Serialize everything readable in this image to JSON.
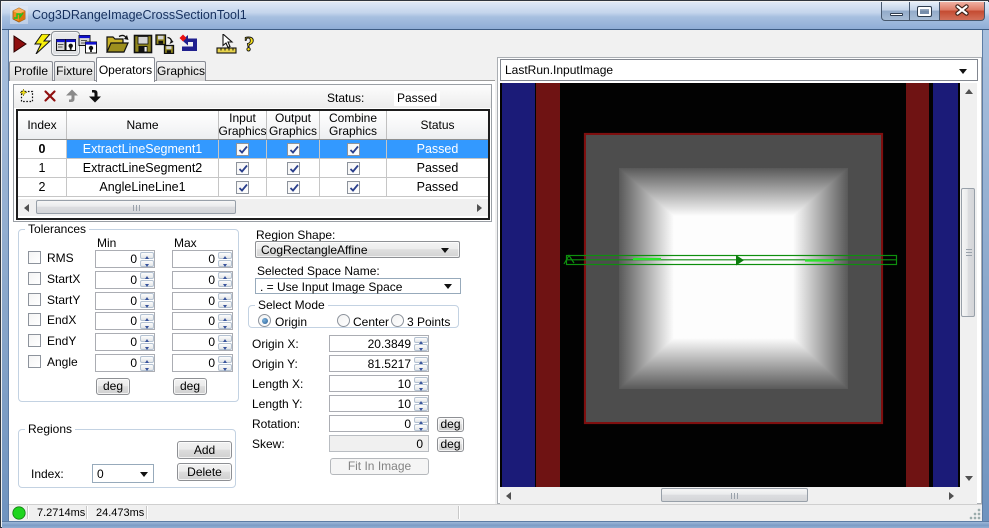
{
  "window": {
    "title": "Cog3DRangeImageCrossSectionTool1",
    "caption_buttons": {
      "minimize": "minimize",
      "maximize": "maximize",
      "close": "close"
    }
  },
  "toolbar": {
    "icons": [
      "run",
      "run-electric",
      "show-result-toggle",
      "float-result-window",
      "open-file",
      "save-file",
      "save-subset",
      "reset-tool",
      "pointer-ruler",
      "help"
    ]
  },
  "tabs": {
    "items": [
      {
        "label": "Profile"
      },
      {
        "label": "Fixture"
      },
      {
        "label": "Operators"
      },
      {
        "label": "Graphics"
      }
    ],
    "active": "Operators"
  },
  "operators": {
    "toolbar_icons": [
      "new-operator",
      "delete-operator",
      "move-up",
      "move-down"
    ],
    "status_label": "Status:",
    "status_value": "Passed",
    "grid": {
      "columns": [
        "Index",
        "Name",
        "Input Graphics",
        "Output Graphics",
        "Combine Graphics",
        "Status"
      ],
      "columns_split": {
        "input": [
          "Input",
          "Graphics"
        ],
        "output": [
          "Output",
          "Graphics"
        ],
        "combine": [
          "Combine",
          "Graphics"
        ]
      },
      "rows": [
        {
          "index": "0",
          "name": "ExtractLineSegment1",
          "input_graphics": true,
          "output_graphics": true,
          "combine_graphics": true,
          "status": "Passed",
          "selected": true
        },
        {
          "index": "1",
          "name": "ExtractLineSegment2",
          "input_graphics": true,
          "output_graphics": true,
          "combine_graphics": true,
          "status": "Passed",
          "selected": false
        },
        {
          "index": "2",
          "name": "AngleLineLine1",
          "input_graphics": true,
          "output_graphics": true,
          "combine_graphics": true,
          "status": "Passed",
          "selected": false
        }
      ]
    }
  },
  "tolerances": {
    "title": "Tolerances",
    "min_header": "Min",
    "max_header": "Max",
    "rows": [
      {
        "label": "RMS",
        "checked": false,
        "min": "0",
        "max": "0"
      },
      {
        "label": "StartX",
        "checked": false,
        "min": "0",
        "max": "0"
      },
      {
        "label": "StartY",
        "checked": false,
        "min": "0",
        "max": "0"
      },
      {
        "label": "EndX",
        "checked": false,
        "min": "0",
        "max": "0"
      },
      {
        "label": "EndY",
        "checked": false,
        "min": "0",
        "max": "0"
      },
      {
        "label": "Angle",
        "checked": false,
        "min": "0",
        "max": "0"
      }
    ],
    "deg_min": "deg",
    "deg_max": "deg"
  },
  "regions": {
    "title": "Regions",
    "add_button": "Add",
    "delete_button": "Delete",
    "index_label": "Index:",
    "index_value": "0"
  },
  "region_editor": {
    "shape_label": "Region Shape:",
    "shape_value": "CogRectangleAffine",
    "space_label": "Selected Space Name:",
    "space_value": ". = Use Input Image Space",
    "select_mode": {
      "title": "Select Mode",
      "options": [
        {
          "label": "Origin",
          "selected": true
        },
        {
          "label": "Center",
          "selected": false
        },
        {
          "label": "3 Points",
          "selected": false
        }
      ]
    },
    "fields": [
      {
        "label": "Origin X:",
        "value": "20.3849"
      },
      {
        "label": "Origin Y:",
        "value": "81.5217"
      },
      {
        "label": "Length X:",
        "value": "10"
      },
      {
        "label": "Length Y:",
        "value": "10"
      },
      {
        "label": "Rotation:",
        "value": "0"
      },
      {
        "label": "Skew:",
        "value": "0"
      }
    ],
    "rotation_deg": "deg",
    "skew_deg": "deg",
    "fit_button": "Fit In Image"
  },
  "display": {
    "source_value": "LastRun.InputImage"
  },
  "statusbar": {
    "run_time": "7.2714ms",
    "total_time": "24.473ms",
    "indicator_color": "#21d521"
  },
  "colors": {
    "selection_blue": "#3399ff",
    "bar_blue": "#1b1b78",
    "bar_red": "#6f1313",
    "square_outline_red": "#8b1010",
    "graphic_green": "#0e8f0e",
    "graphic_bright_green": "#2ae42a"
  }
}
